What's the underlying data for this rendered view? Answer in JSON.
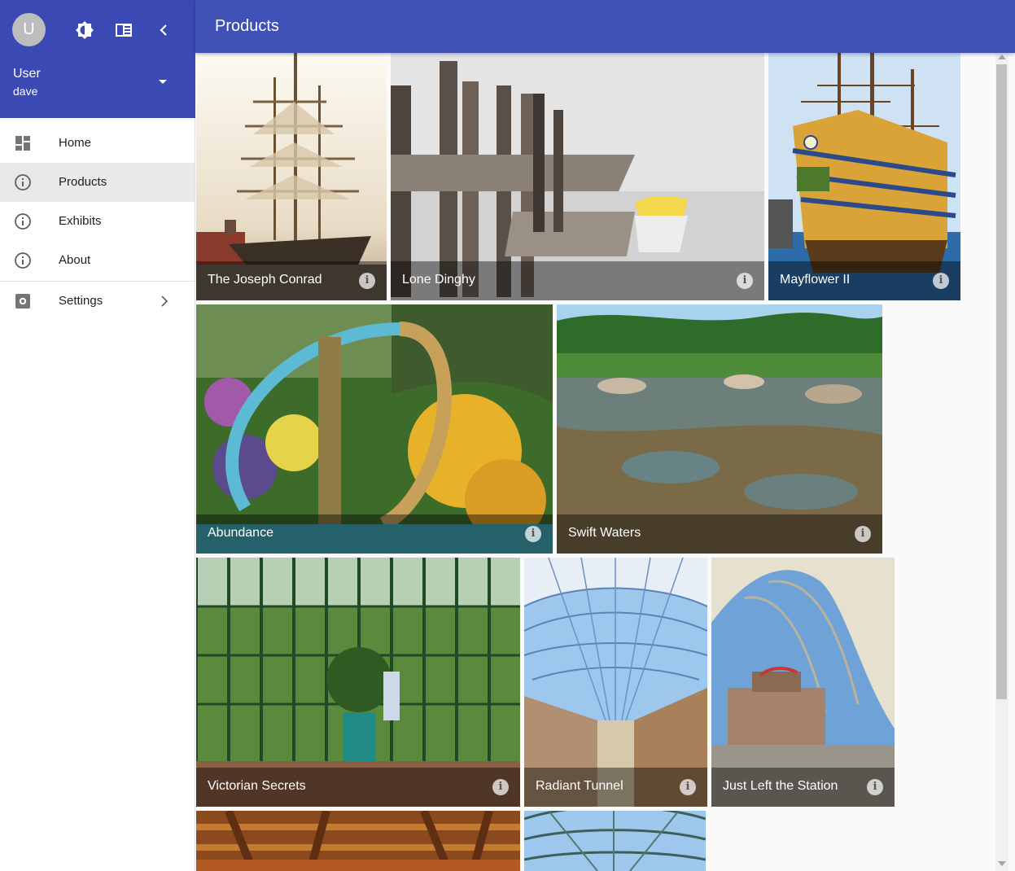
{
  "drawer": {
    "avatar_initial": "U",
    "user_label": "User",
    "user_name": "dave",
    "icons": [
      "brightness-icon",
      "drawer-layout-icon",
      "chevron-left-icon",
      "arrow-drop-down-icon"
    ],
    "nav": [
      {
        "label": "Home",
        "icon": "dashboard-icon"
      },
      {
        "label": "Products",
        "icon": "info-icon",
        "active": true
      },
      {
        "label": "Exhibits",
        "icon": "info-icon"
      },
      {
        "label": "About",
        "icon": "info-icon"
      },
      {
        "label": "Settings",
        "icon": "settings-icon"
      }
    ]
  },
  "appbar": {
    "title": "Products"
  },
  "tiles": [
    {
      "title": "The Joseph Conrad"
    },
    {
      "title": "Lone Dinghy"
    },
    {
      "title": "Mayflower II"
    },
    {
      "title": "Abundance"
    },
    {
      "title": "Swift Waters"
    },
    {
      "title": "Victorian Secrets"
    },
    {
      "title": "Radiant Tunnel"
    },
    {
      "title": "Just Left the Station"
    },
    {
      "title": ""
    },
    {
      "title": ""
    }
  ],
  "colors": {
    "primary": "#3f51b5",
    "drawer_header": "#3a49b4",
    "active_nav": "#e9e9e9"
  }
}
